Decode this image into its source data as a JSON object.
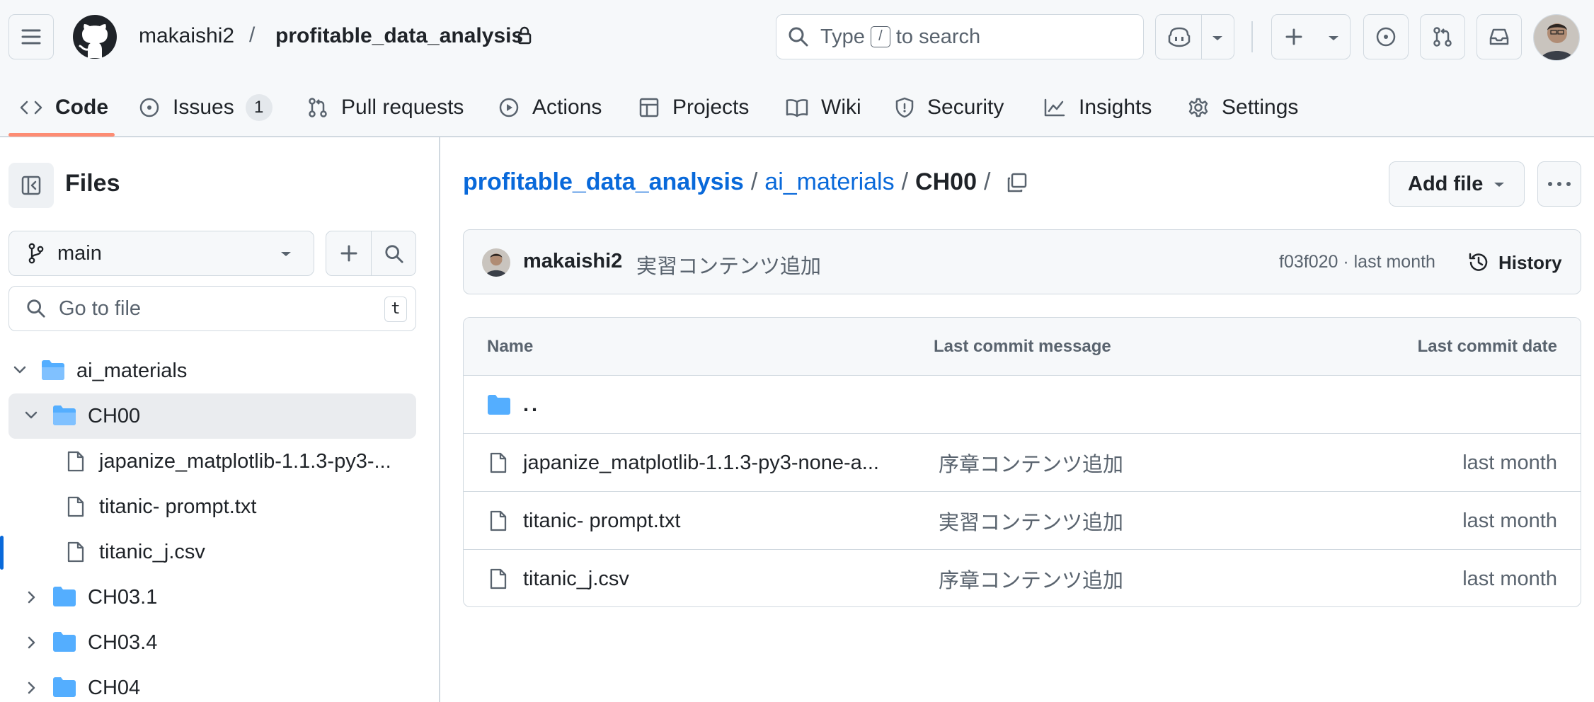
{
  "header": {
    "owner": "makaishi2",
    "separator": "/",
    "repo": "profitable_data_analysis",
    "search_prefix": "Type",
    "search_key": "/",
    "search_suffix": "to search"
  },
  "tabs": [
    {
      "label": "Code",
      "icon": "code-icon"
    },
    {
      "label": "Issues",
      "icon": "issue-opened-icon",
      "count": "1"
    },
    {
      "label": "Pull requests",
      "icon": "git-pull-request-icon"
    },
    {
      "label": "Actions",
      "icon": "play-icon"
    },
    {
      "label": "Projects",
      "icon": "table-icon"
    },
    {
      "label": "Wiki",
      "icon": "book-icon"
    },
    {
      "label": "Security",
      "icon": "shield-icon"
    },
    {
      "label": "Insights",
      "icon": "graph-icon"
    },
    {
      "label": "Settings",
      "icon": "gear-icon"
    }
  ],
  "sidebar": {
    "title": "Files",
    "branch": "main",
    "goto_placeholder": "Go to file",
    "goto_shortcut": "t",
    "tree": [
      {
        "name": "ai_materials",
        "type": "folder",
        "expanded": true
      },
      {
        "name": "CH00",
        "type": "folder",
        "expanded": true,
        "selected": true
      },
      {
        "name": "japanize_matplotlib-1.1.3-py3-...",
        "type": "file"
      },
      {
        "name": "titanic- prompt.txt",
        "type": "file"
      },
      {
        "name": "titanic_j.csv",
        "type": "file"
      },
      {
        "name": "CH03.1",
        "type": "folder",
        "expanded": false
      },
      {
        "name": "CH03.4",
        "type": "folder",
        "expanded": false
      },
      {
        "name": "CH04",
        "type": "folder",
        "expanded": false
      }
    ]
  },
  "breadcrumb": {
    "root": "profitable_data_analysis",
    "folder": "ai_materials",
    "current": "CH00",
    "slash": "/"
  },
  "actions": {
    "add_file": "Add file"
  },
  "commit": {
    "author": "makaishi2",
    "message": "実習コンテンツ追加",
    "sha_and_time": "f03f020 · last month",
    "history_label": "History"
  },
  "table": {
    "headers": {
      "name": "Name",
      "message": "Last commit message",
      "date": "Last commit date"
    },
    "parent": "..",
    "rows": [
      {
        "name": "japanize_matplotlib-1.1.3-py3-none-a...",
        "message": "序章コンテンツ追加",
        "date": "last month"
      },
      {
        "name": "titanic- prompt.txt",
        "message": "実習コンテンツ追加",
        "date": "last month"
      },
      {
        "name": "titanic_j.csv",
        "message": "序章コンテンツ追加",
        "date": "last month"
      }
    ]
  },
  "colors": {
    "accent_link": "#0969da",
    "tab_underline": "#fd8c73",
    "folder": "#54aeff",
    "muted_text": "#59636e",
    "border": "#d1d9e0"
  }
}
